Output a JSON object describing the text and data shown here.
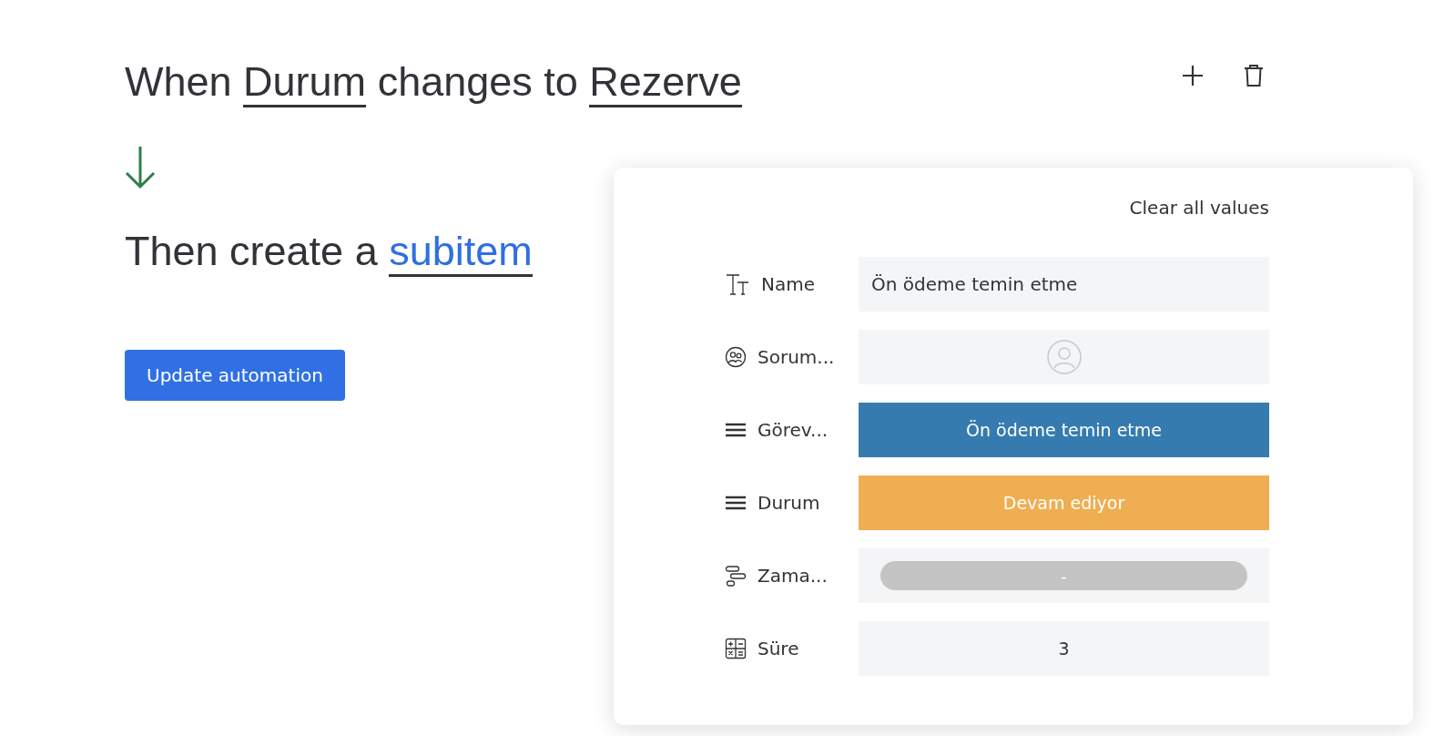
{
  "trigger": {
    "parts": [
      {
        "kind": "text",
        "text": "When"
      },
      {
        "kind": "field",
        "text": "Durum"
      },
      {
        "kind": "text",
        "text": "changes to"
      },
      {
        "kind": "field",
        "text": "Rezerve"
      }
    ]
  },
  "action": {
    "parts": [
      {
        "kind": "text",
        "text": "Then create a"
      },
      {
        "kind": "link",
        "text": "subitem"
      }
    ]
  },
  "update_button": "Update automation",
  "panel": {
    "clear_label": "Clear all values",
    "fields": [
      {
        "kind": "text",
        "label": "Name",
        "value": "Ön ödeme temin etme"
      },
      {
        "kind": "person",
        "label": "Sorum..."
      },
      {
        "kind": "status",
        "label": "Görev...",
        "value": "Ön ödeme temin etme",
        "color": "#357bb0"
      },
      {
        "kind": "status",
        "label": "Durum",
        "value": "Devam ediyor",
        "color": "#f0ae52"
      },
      {
        "kind": "timeline",
        "label": "Zama...",
        "value": "-"
      },
      {
        "kind": "number",
        "label": "Süre",
        "value": "3"
      }
    ]
  }
}
